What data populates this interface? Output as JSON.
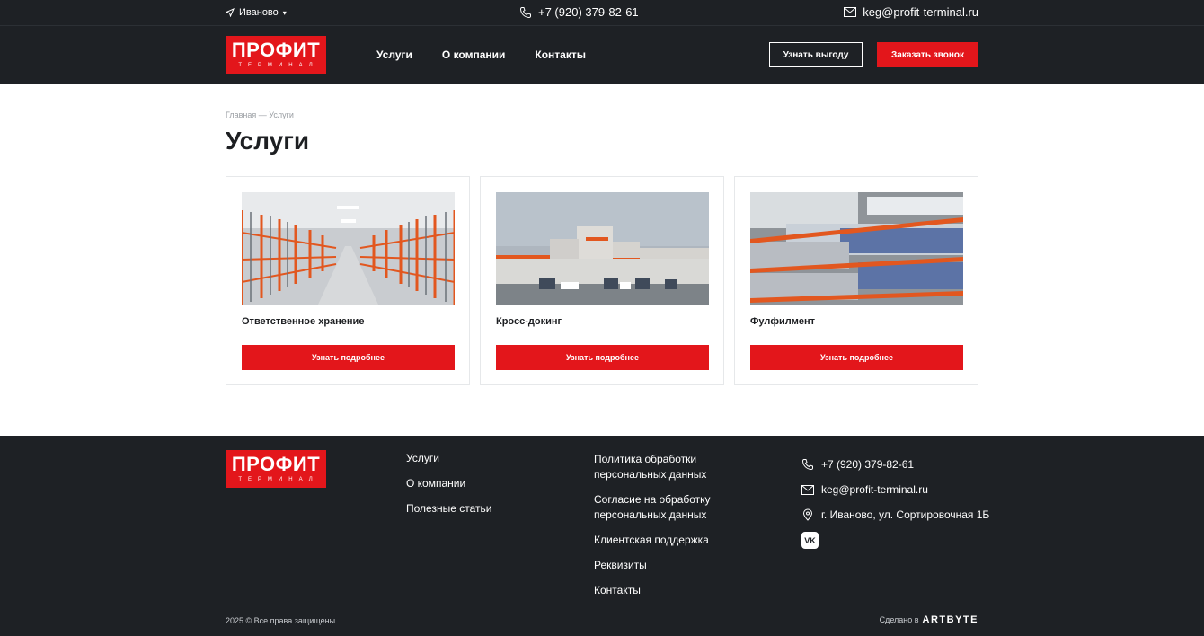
{
  "topbar": {
    "city": "Иваново",
    "phone": "+7 (920) 379-82-61",
    "email": "keg@profit-terminal.ru"
  },
  "logo": {
    "main": "ПРОФИТ",
    "sub": "ТЕРМИНАЛ"
  },
  "nav": [
    "Услуги",
    "О компании",
    "Контакты"
  ],
  "header": {
    "benefit_label": "Узнать выгоду",
    "callback_label": "Заказать звонок"
  },
  "breadcrumb": "Главная — Услуги",
  "page_title": "Услуги",
  "cards": [
    {
      "title": "Ответственное хранение",
      "button": "Узнать подробнее",
      "image": "warehouse-racks"
    },
    {
      "title": "Кросс-докинг",
      "button": "Узнать подробнее",
      "image": "terminal-building"
    },
    {
      "title": "Фулфилмент",
      "button": "Узнать подробнее",
      "image": "textile-storage"
    }
  ],
  "footer": {
    "col1": [
      "Услуги",
      "О компании",
      "Полезные статьи"
    ],
    "col2": [
      [
        "Политика обработки",
        "персональных данных"
      ],
      [
        "Согласие на обработку",
        "персональных данных"
      ],
      [
        "Клиентская поддержка"
      ],
      [
        "Реквизиты"
      ],
      [
        "Контакты"
      ]
    ],
    "phone": "+7 (920) 379-82-61",
    "email": "keg@profit-terminal.ru",
    "address": "г. Иваново, ул. Сортировочная 1Б",
    "vk": "VK",
    "copyright": "2025 © Все права защищены.",
    "made_by": "Сделано в",
    "made_by_brand": "ARTBYTE"
  },
  "colors": {
    "brand_red": "#e3161b",
    "dark_bg": "#1e2125"
  }
}
